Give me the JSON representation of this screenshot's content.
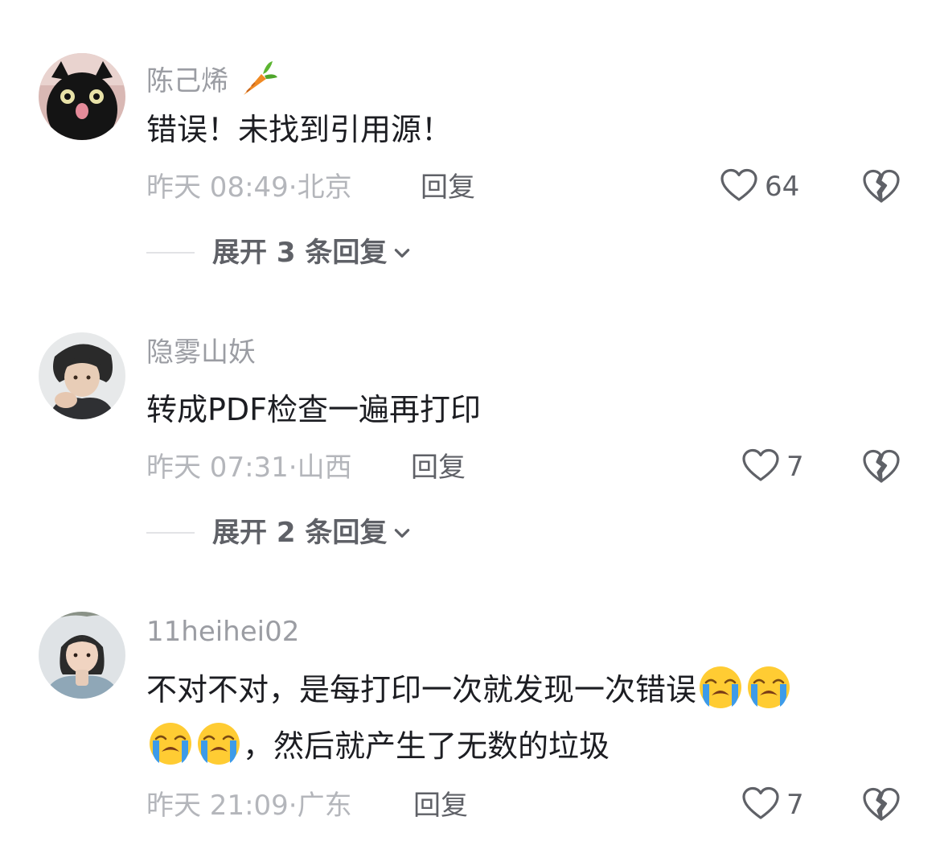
{
  "comments": [
    {
      "username": "陈己烯",
      "username_emoji": "carrot-icon",
      "text": "错误！未找到引用源！",
      "time": "昨天 08:49",
      "sep": "·",
      "location": "北京",
      "reply_label": "回复",
      "likes": "64",
      "expand_label": "展开 3 条回复"
    },
    {
      "username": "隐雾山妖",
      "text": "转成PDF检查一遍再打印",
      "time": "昨天 07:31",
      "sep": "·",
      "location": "山西",
      "reply_label": "回复",
      "likes": "7",
      "expand_label": "展开 2 条回复"
    },
    {
      "username": "11heihei02",
      "text_line1_prefix": "不对不对，是每打印一次就发现一次错误",
      "text_line2_suffix": "，然后就产生了无数的垃圾",
      "emojis": [
        "crying-face-icon",
        "crying-face-icon",
        "crying-face-icon",
        "crying-face-icon"
      ],
      "time": "昨天 21:09",
      "sep": "·",
      "location": "广东",
      "reply_label": "回复",
      "likes": "7"
    }
  ],
  "colors": {
    "username": "#9b9da3",
    "text": "#1c1d22",
    "meta": "#b4b6bb",
    "action": "#5f6167"
  }
}
